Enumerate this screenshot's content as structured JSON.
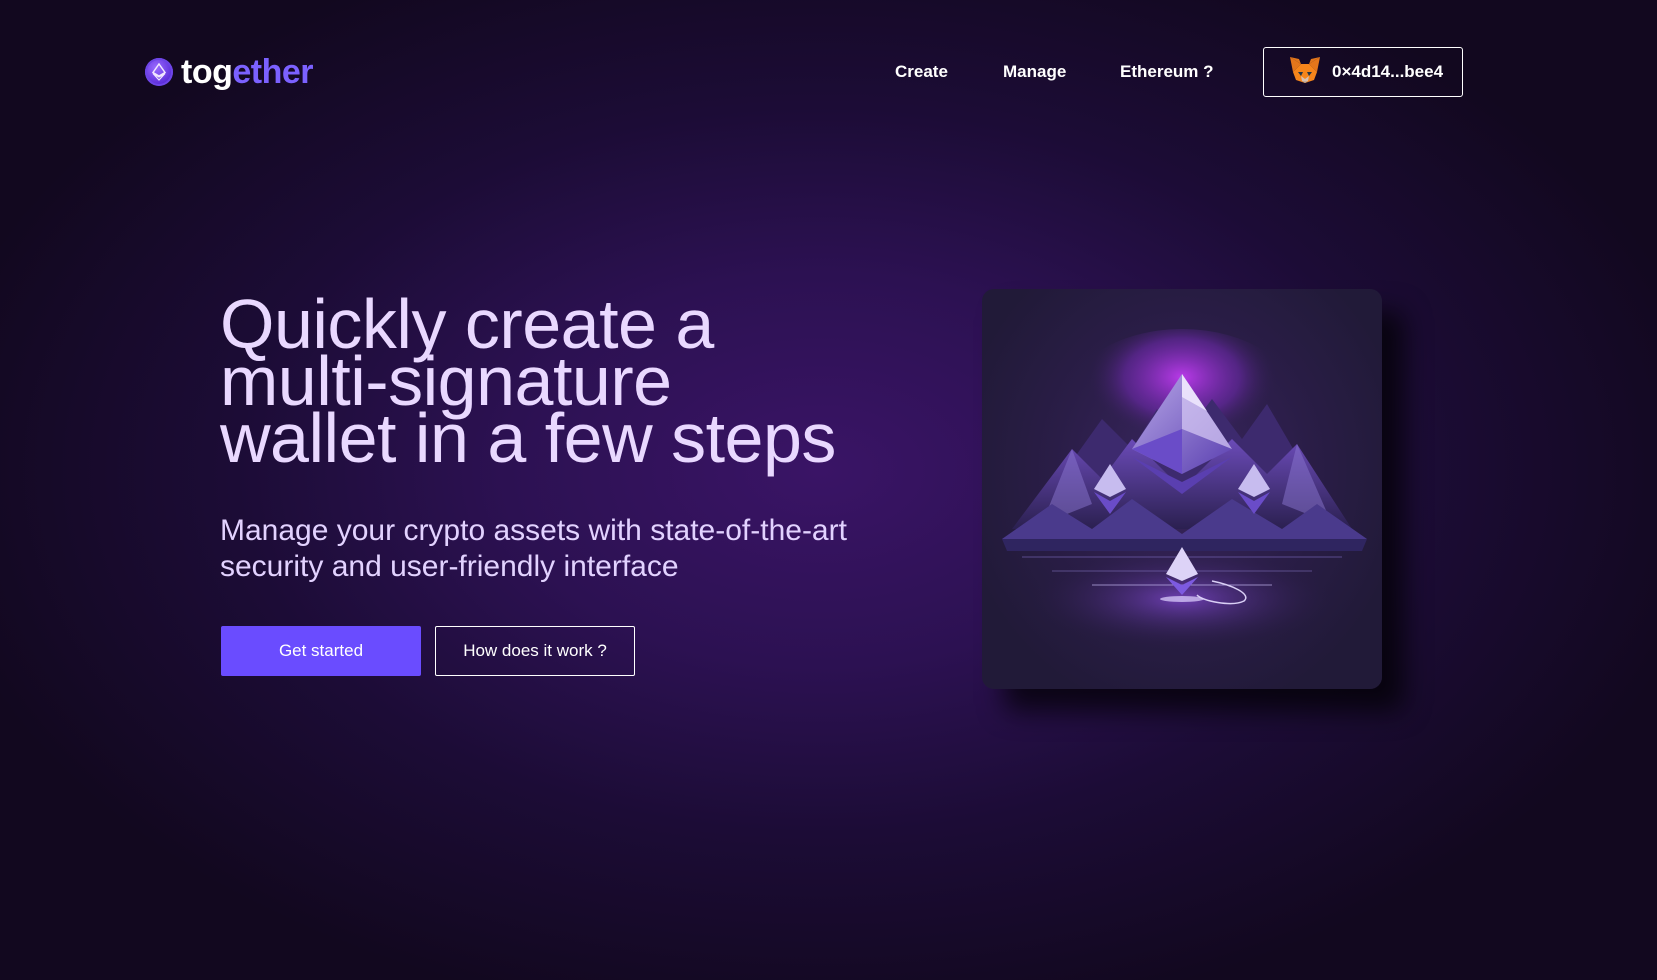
{
  "brand": {
    "name_part1": "tog",
    "name_part2": "ether",
    "accent": "#7b61ff",
    "icon": "ethereum-icon"
  },
  "nav": {
    "links": [
      {
        "label": "Create"
      },
      {
        "label": "Manage"
      },
      {
        "label": "Ethereum ?"
      }
    ],
    "wallet": {
      "address": "0×4d14...bee4",
      "icon": "metamask-fox-icon"
    }
  },
  "hero": {
    "title_lines": [
      "Quickly create a",
      "multi-signature",
      "wallet in a few steps"
    ],
    "subtitle_lines": [
      "Manage your crypto assets with state-of-the-art",
      "security and user-friendly interface"
    ],
    "primary_button": "Get started",
    "secondary_button": "How does it work ?",
    "primary_color": "#6a4cff",
    "title_color": "#e9d8ff"
  },
  "illustration": {
    "icon": "ethereum-mountains-illustration"
  }
}
